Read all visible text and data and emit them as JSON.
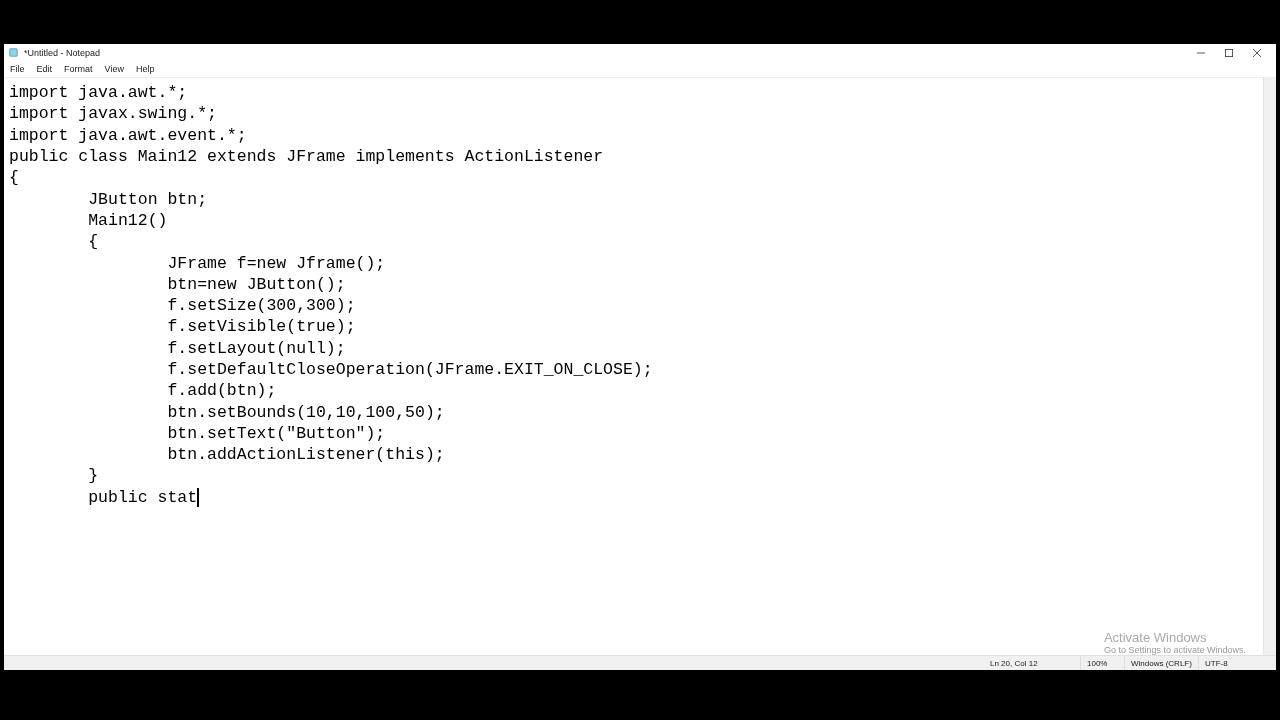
{
  "window": {
    "title": "*Untitled - Notepad"
  },
  "menu": [
    "File",
    "Edit",
    "Format",
    "View",
    "Help"
  ],
  "editor": {
    "lines": [
      "import java.awt.*;",
      "import javax.swing.*;",
      "import java.awt.event.*;",
      "public class Main12 extends JFrame implements ActionListener",
      "{",
      "\tJButton btn;",
      "\tMain12()",
      "\t{",
      "\t\tJFrame f=new Jframe();",
      "\t\tbtn=new JButton();",
      "\t\tf.setSize(300,300);",
      "\t\tf.setVisible(true);",
      "\t\tf.setLayout(null);",
      "\t\tf.setDefaultCloseOperation(JFrame.EXIT_ON_CLOSE);",
      "\t\tf.add(btn);",
      "\t\tbtn.setBounds(10,10,100,50);",
      "\t\tbtn.setText(\"Button\");",
      "\t\tbtn.addActionListener(this);",
      "\t}",
      "\tpublic stat"
    ]
  },
  "activation": {
    "title": "Activate Windows",
    "subtitle": "Go to Settings to activate Windows."
  },
  "status_bar": {
    "position": "Ln 20, Col 12",
    "zoom": "100%",
    "line_ending": "Windows (CRLF)",
    "encoding": "UTF-8"
  }
}
